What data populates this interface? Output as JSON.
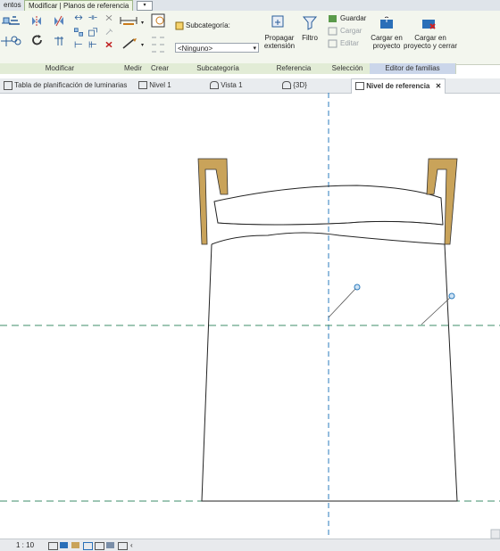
{
  "ribbon_tabs": [
    {
      "label": "entos",
      "active": false
    },
    {
      "label": "Modificar | Planos de referencia",
      "active": true
    }
  ],
  "subcategory": {
    "label": "Subcategoría:",
    "value": "<Ninguno>"
  },
  "buttons": {
    "propagar": "Propagar\nextensión",
    "filtro": "Filtro",
    "guardar": "Guardar",
    "cargar": "Cargar",
    "editar": "Editar",
    "cargar_proyecto": "Cargar en\nproyecto",
    "cargar_cerrar": "Cargar en\nproyecto y cerrar"
  },
  "panels": {
    "modificar": "Modificar",
    "medir": "Medir",
    "crear": "Crear",
    "subcategoria": "Subcategoría",
    "referencia": "Referencia",
    "seleccion": "Selección",
    "editor": "Editor de familias"
  },
  "view_tabs": [
    {
      "label": "Tabla de planificación de luminarias",
      "icon": "schedule-icon",
      "active": false
    },
    {
      "label": "Nivel 1",
      "icon": "plan-view-icon",
      "active": false
    },
    {
      "label": "Vista 1",
      "icon": "view-icon",
      "active": false
    },
    {
      "label": "{3D}",
      "icon": "3d-view-icon",
      "active": false
    },
    {
      "label": "Nivel de referencia",
      "icon": "plan-view-icon",
      "active": true
    }
  ],
  "close_glyph": "✕",
  "status": {
    "scale": "1 : 10"
  },
  "colors": {
    "accent_green": "#9fb78a",
    "ref_plane": "#2b7bbd",
    "level_line": "#3c8c6a",
    "lamp_gold": "#c9a35a"
  }
}
